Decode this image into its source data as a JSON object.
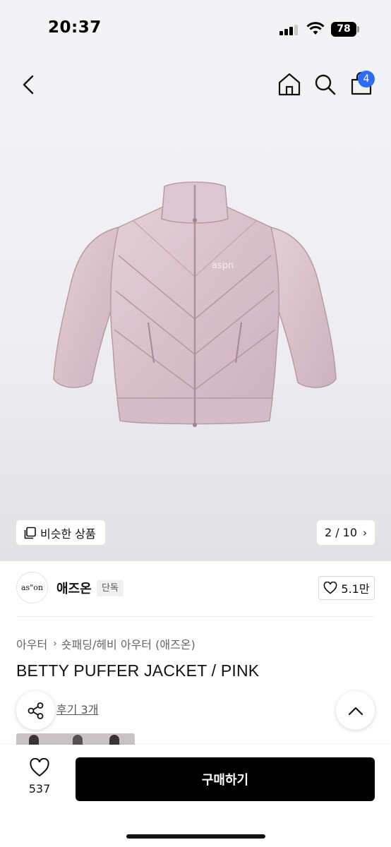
{
  "status_bar": {
    "time": "20:37",
    "battery": "78"
  },
  "nav": {
    "cart_count": "4",
    "icons": [
      "back-chevron-icon",
      "home-icon",
      "search-icon",
      "shopping-bag-icon"
    ]
  },
  "gallery": {
    "similar_label": "비슷한 상품",
    "pager": "2 / 10",
    "jacket_logo": "aspn"
  },
  "brand": {
    "logo_text": "as\"on",
    "name": "애즈온",
    "badge": "단독",
    "like_count": "5.1만"
  },
  "category": {
    "level1": "아우터",
    "level2": "숏패딩/헤비 아우터 (애즈온)"
  },
  "product": {
    "title": "BETTY PUFFER JACKET / PINK",
    "reviews": "후기 3개"
  },
  "bottom": {
    "wish_count": "537",
    "buy_label": "구매하기"
  },
  "colors": {
    "accent": "#2f6cf6",
    "jacket": "#d9c2cb",
    "buy_button": "#000000"
  }
}
